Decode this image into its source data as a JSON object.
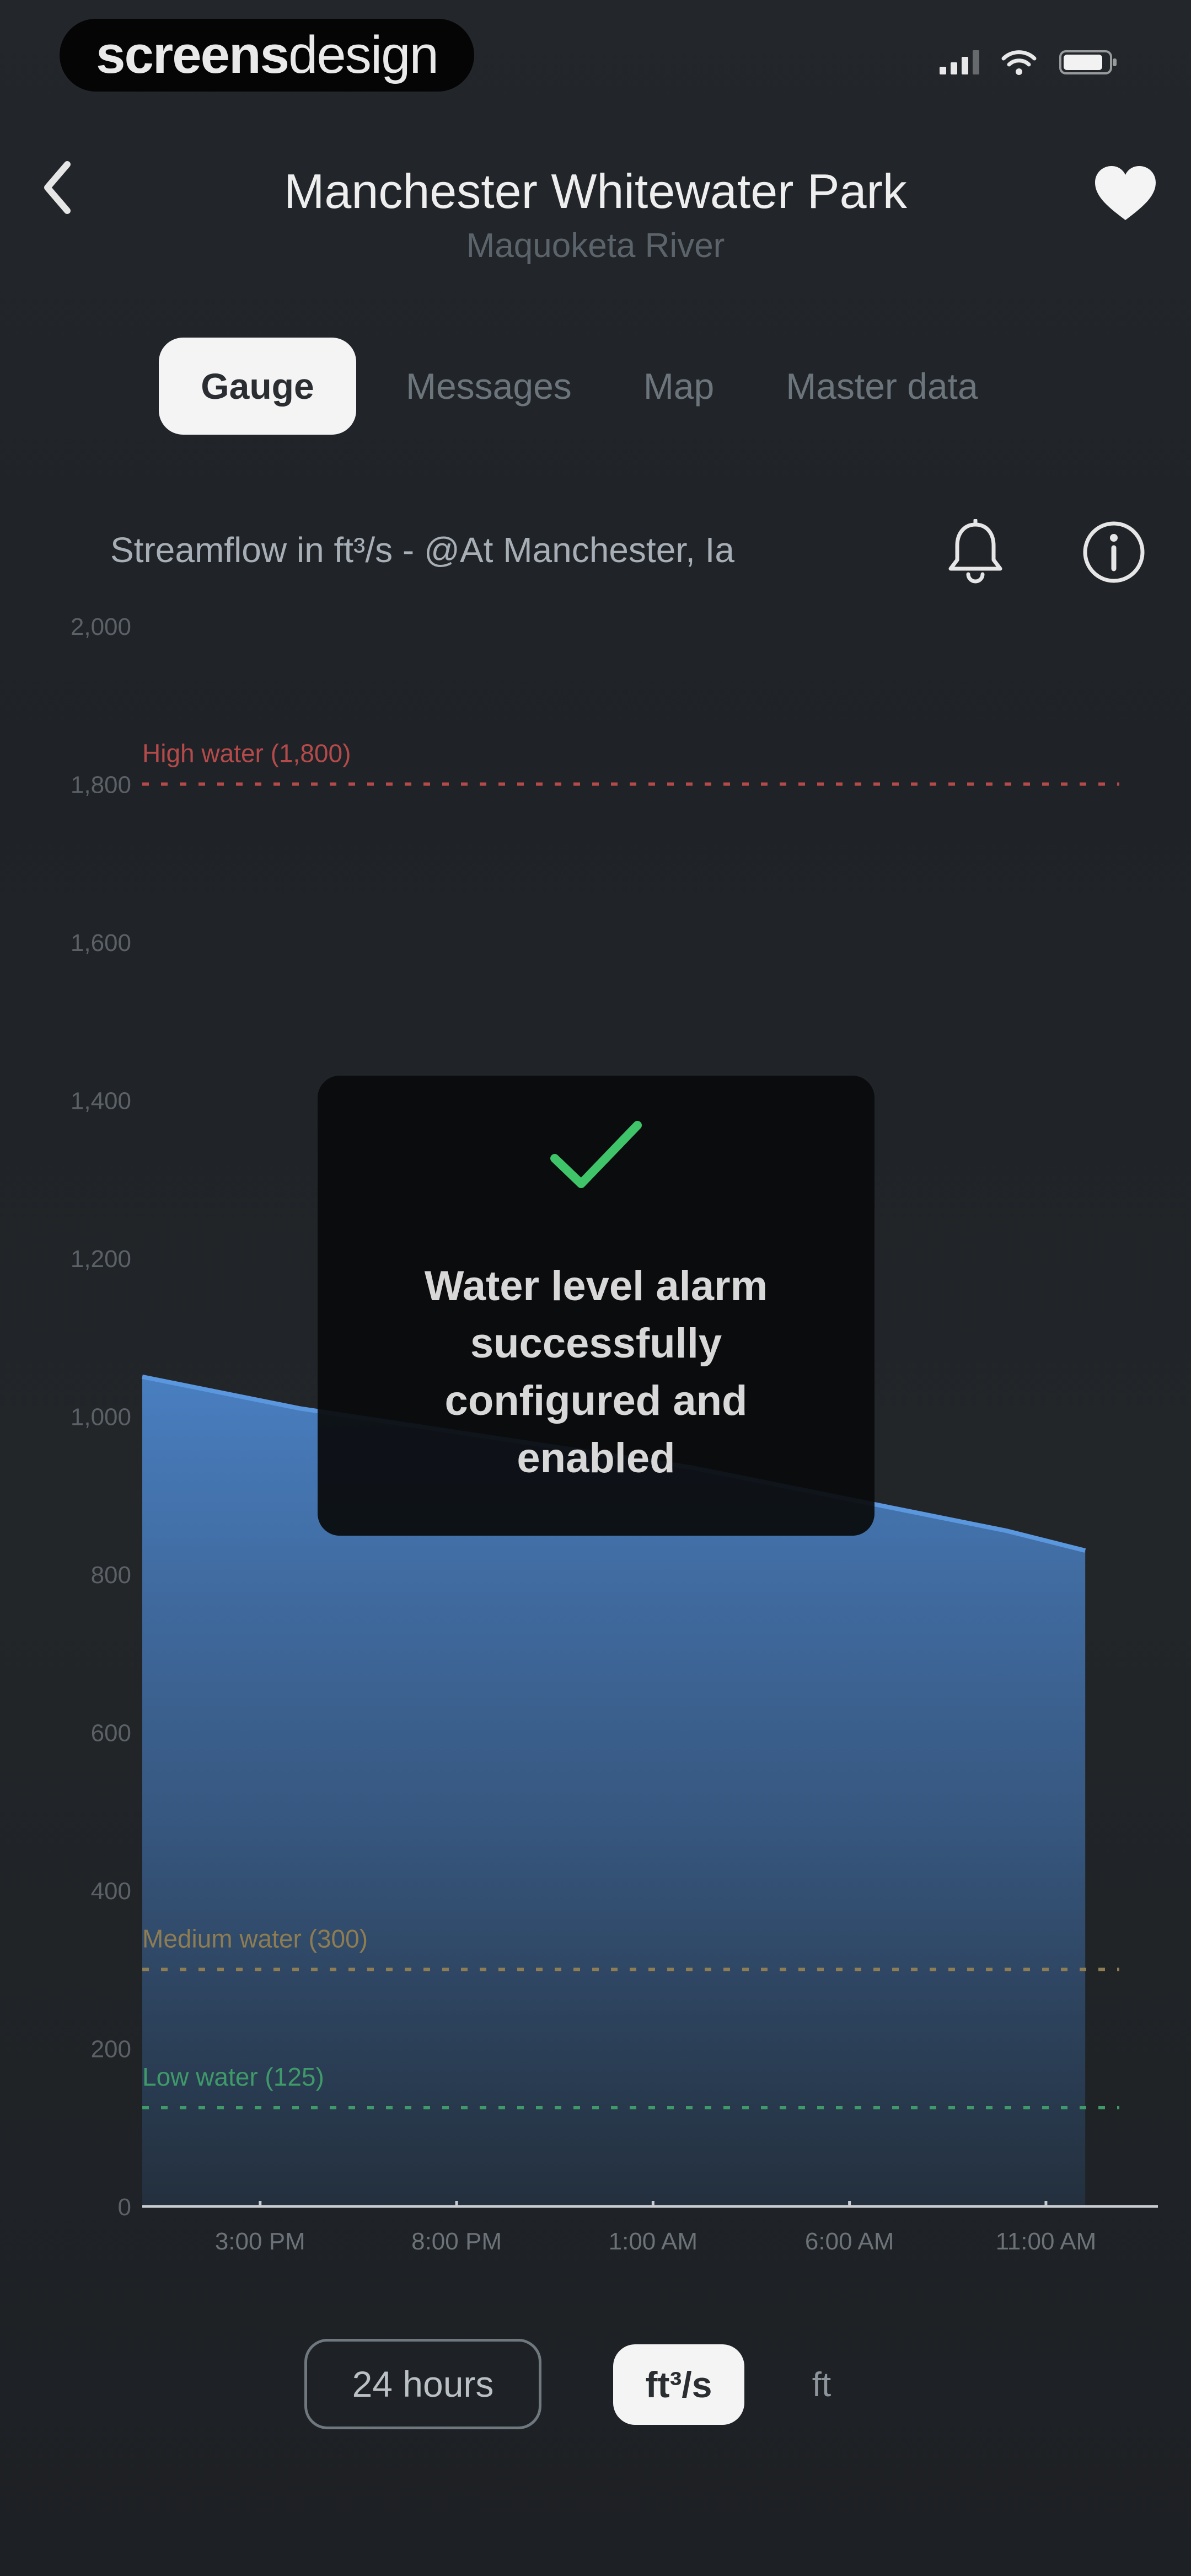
{
  "status_bar": {
    "watermark_part1": "screens",
    "watermark_part2": "design",
    "icons": [
      "signal-icon",
      "wifi-icon",
      "battery-icon"
    ]
  },
  "header": {
    "title": "Manchester Whitewater Park",
    "subtitle": "Maquoketa River",
    "back_icon": "chevron-left-icon",
    "favorite_icon": "heart-icon"
  },
  "tabs": [
    {
      "label": "Gauge",
      "active": true
    },
    {
      "label": "Messages",
      "active": false
    },
    {
      "label": "Map",
      "active": false
    },
    {
      "label": "Master data",
      "active": false
    }
  ],
  "chart_header": {
    "caption": "Streamflow in ft³/s - @At Manchester, Ia",
    "alarm_icon": "bell-icon",
    "info_icon": "info-icon"
  },
  "chart_data": {
    "type": "area",
    "ylabel": "",
    "xlabel": "",
    "ylim": [
      0,
      2000
    ],
    "yticks": [
      0,
      200,
      400,
      600,
      800,
      1000,
      1200,
      1400,
      1600,
      1800,
      2000
    ],
    "ytick_labels": [
      "0",
      "200",
      "400",
      "600",
      "800",
      "1,000",
      "1,200",
      "1,400",
      "1,600",
      "1,800",
      "2,000"
    ],
    "xlim": [
      -3,
      21.25
    ],
    "xticks": [
      0,
      5,
      10,
      15,
      20
    ],
    "xtick_labels": [
      "3:00 PM",
      "8:00 PM",
      "1:00 AM",
      "6:00 AM",
      "11:00 AM"
    ],
    "series": [
      {
        "x": [
          -3,
          -1,
          1,
          3,
          5,
          7,
          9,
          11,
          13,
          15,
          17,
          19,
          21
        ],
        "y": [
          1050,
          1030,
          1010,
          995,
          980,
          965,
          950,
          935,
          915,
          895,
          875,
          855,
          830
        ]
      }
    ],
    "thresholds": [
      {
        "label": "High water (1,800)",
        "value": 1800,
        "color": "#b54a4a"
      },
      {
        "label": "Medium water (300)",
        "value": 300,
        "color": "#8e7c52"
      },
      {
        "label": "Low water (125)",
        "value": 125,
        "color": "#3f9a6a"
      }
    ],
    "area_color": "#4b83c8",
    "grid": false
  },
  "toast": {
    "icon": "checkmark-icon",
    "lines": [
      "Water level alarm",
      "successfully",
      "configured and",
      "enabled"
    ],
    "accent": "#3fc46a"
  },
  "controls": {
    "range_label": "24 hours",
    "unit_selected": "ft³/s",
    "unit_other": "ft"
  }
}
